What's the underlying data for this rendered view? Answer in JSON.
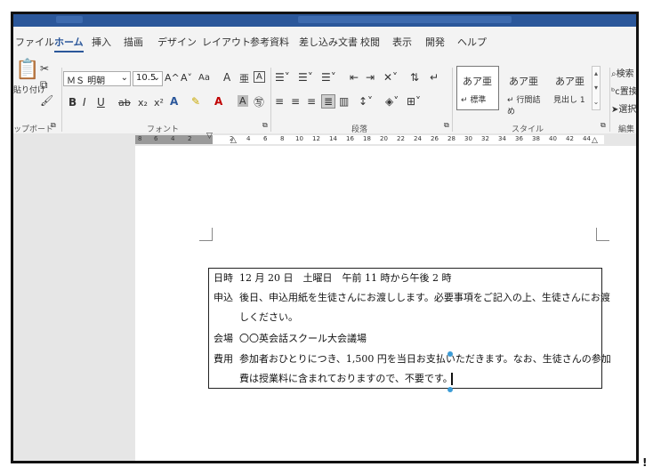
{
  "menu": {
    "tabs": [
      {
        "label": "ファイル",
        "active": false
      },
      {
        "label": "ホーム",
        "active": true
      },
      {
        "label": "挿入",
        "active": false
      },
      {
        "label": "描画",
        "active": false
      },
      {
        "label": "デザイン",
        "active": false
      },
      {
        "label": "レイアウト",
        "active": false
      },
      {
        "label": "参考資料",
        "active": false
      },
      {
        "label": "差し込み文書",
        "active": false
      },
      {
        "label": "校閲",
        "active": false
      },
      {
        "label": "表示",
        "active": false
      },
      {
        "label": "開発",
        "active": false
      },
      {
        "label": "ヘルプ",
        "active": false
      }
    ]
  },
  "ribbon": {
    "clipboard": {
      "paste_label": "貼り付け",
      "group_label": "ップボード"
    },
    "font": {
      "name": "ＭＳ 明朝",
      "size": "10.5",
      "grow": "A^",
      "shrink": "A˅",
      "case": "Aa",
      "bold": "B",
      "italic": "I",
      "underline": "U",
      "strike": "ab",
      "subscript": "x₂",
      "superscript": "x²",
      "group_label": "フォント"
    },
    "paragraph": {
      "group_label": "段落"
    },
    "styles": {
      "items": [
        {
          "preview": "あア亜",
          "name": "↵ 標準"
        },
        {
          "preview": "あア亜",
          "name": "↵ 行間詰め"
        },
        {
          "preview": "あア亜",
          "name": "見出し 1"
        }
      ],
      "group_label": "スタイル"
    },
    "editing": {
      "search": "検索",
      "replace": "置換",
      "select": "選択",
      "group_label": "編集"
    }
  },
  "ruler": {
    "numbers": [
      "8",
      "6",
      "4",
      "2",
      "2",
      "4",
      "6",
      "8",
      "10",
      "12",
      "14",
      "16",
      "18",
      "20",
      "22",
      "24",
      "26",
      "28",
      "30",
      "32",
      "34",
      "36",
      "38",
      "40",
      "42",
      "44"
    ]
  },
  "notice": {
    "rows": [
      {
        "label": "日時",
        "text": "12 月 20 日　土曜日　午前 11 時から午後 2 時"
      },
      {
        "label": "申込",
        "text": "後日、申込用紙を生徒さんにお渡しします。必要事項をご記入の上、生徒さんにお渡"
      },
      {
        "label": "",
        "text": "しください。"
      },
      {
        "label": "会場",
        "text": "〇〇英会話スクール大会議場"
      },
      {
        "label": "費用",
        "text": "参加者おひとりにつき、1,500 円を当日お支払いただきます。なお、生徒さんの参加"
      },
      {
        "label": "",
        "text": "費は授業料に含まれておりますので、不要です。"
      }
    ]
  },
  "colors": {
    "ribbon_accent": "#2b579a",
    "selection_handle": "#3c9cd6"
  }
}
